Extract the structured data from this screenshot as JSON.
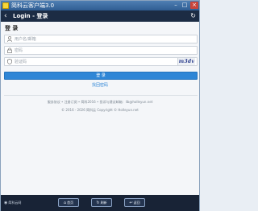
{
  "window": {
    "title": "简科云客户端3.0",
    "minimize": "–",
    "maximize": "□",
    "close": "×"
  },
  "header": {
    "back_glyph": "‹",
    "title": "Login - 登录",
    "refresh_glyph": "↻"
  },
  "form": {
    "section_title": "登 录",
    "username_placeholder": "用户名/邮箱",
    "password_placeholder": "密码",
    "captcha_placeholder": "验证码",
    "captcha_text": "m3dv",
    "login_label": "登 录",
    "forgot_label": "找回密码"
  },
  "footer_text": {
    "links": "服务协议 • 注册订阅 • 简科2016 • 投诉与建议邮箱：lib@holleyun.net",
    "copyright": "© 2016 - 2026 简科云 Copyright © Holleyun.net"
  },
  "bottom_bar": {
    "home_text": "简科云网",
    "buttons": [
      {
        "label": "首页"
      },
      {
        "label": "刷新"
      },
      {
        "label": "返回"
      }
    ]
  },
  "colors": {
    "accent": "#2f86d6",
    "header_bg": "#1c2c44",
    "footer_bg": "#182336"
  }
}
